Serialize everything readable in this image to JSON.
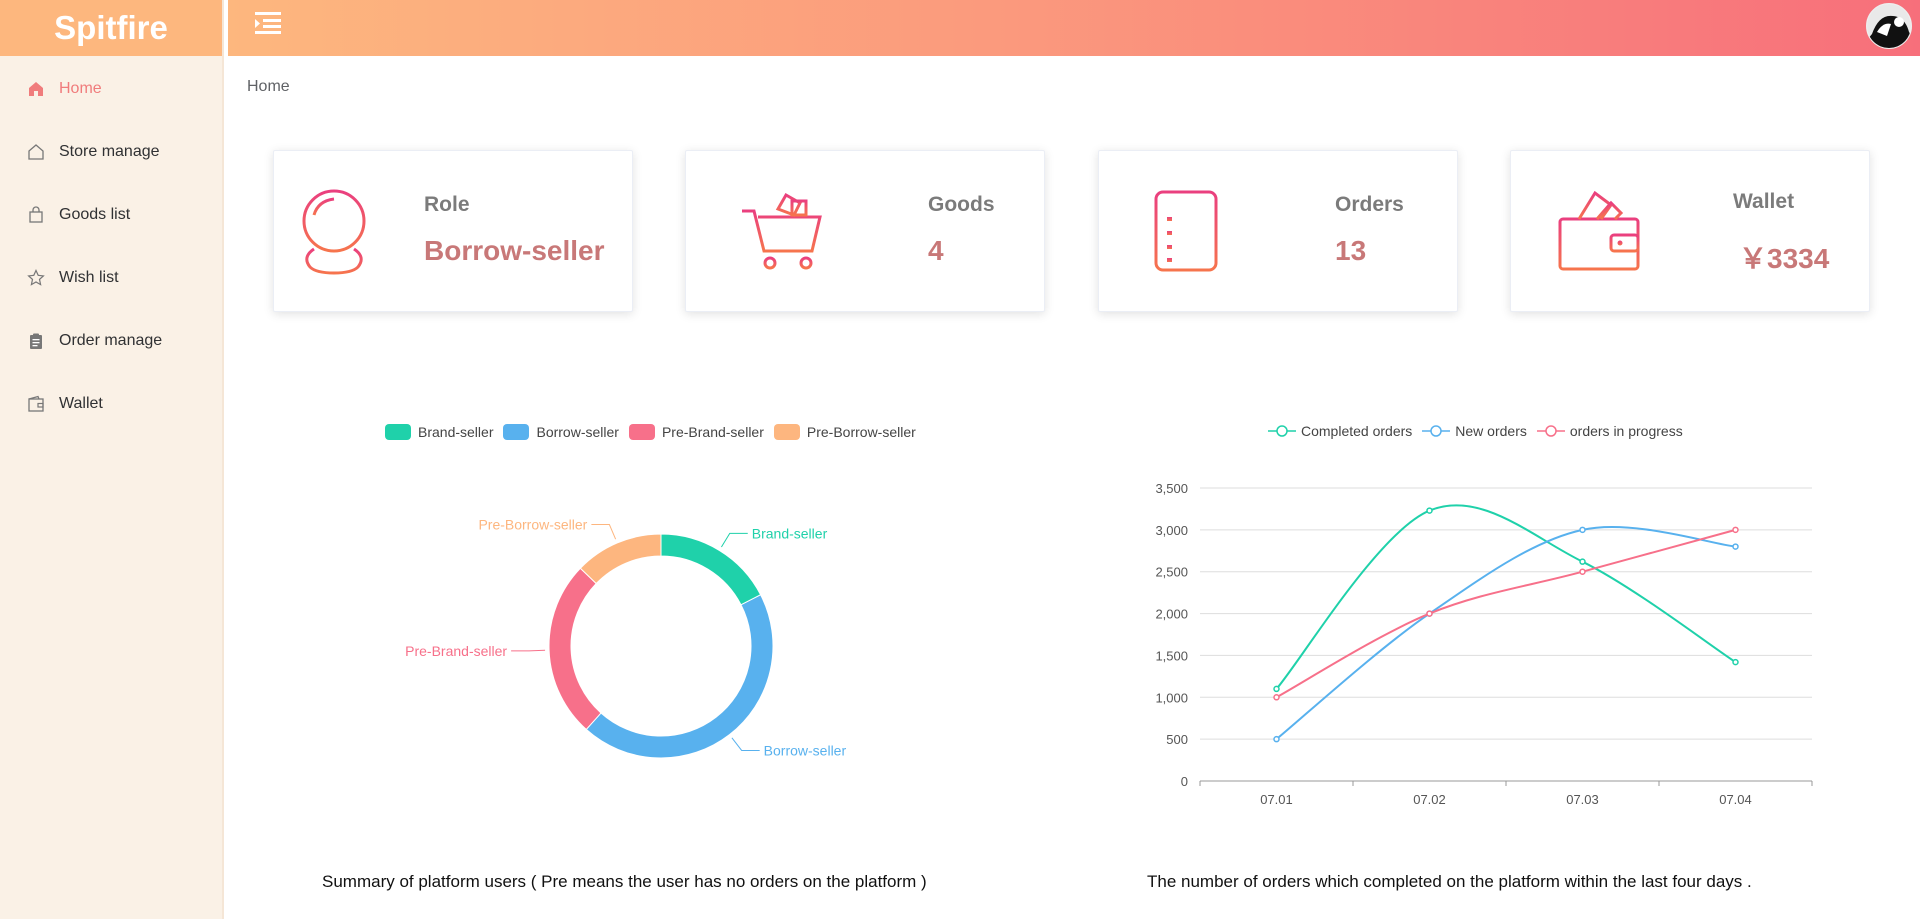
{
  "app": {
    "logo": "Spitfire"
  },
  "sidebar": {
    "items": [
      {
        "label": "Home",
        "icon": "home-icon",
        "active": true
      },
      {
        "label": "Store manage",
        "icon": "store-icon"
      },
      {
        "label": "Goods list",
        "icon": "shopping-bag-icon"
      },
      {
        "label": "Wish list",
        "icon": "star-icon"
      },
      {
        "label": "Order manage",
        "icon": "clipboard-icon"
      },
      {
        "label": "Wallet",
        "icon": "wallet-icon"
      }
    ]
  },
  "header": {
    "menu_icon": "hamburger-icon",
    "avatar_icon": "user-avatar-icon"
  },
  "breadcrumb": "Home",
  "cards": [
    {
      "title": "Role",
      "value": "Borrow-seller",
      "icon": "user-outline-icon"
    },
    {
      "title": "Goods",
      "value": "4",
      "icon": "shopping-cart-icon"
    },
    {
      "title": "Orders",
      "value": "13",
      "icon": "order-list-icon"
    },
    {
      "title": "Wallet",
      "value": "￥3334",
      "icon": "wallet-icon"
    }
  ],
  "colors": {
    "accent": "#f07c7c",
    "brand_seller": "#1fd1aa",
    "borrow_seller": "#58b1ee",
    "pre_brand_seller": "#f7708a",
    "pre_borrow_seller": "#fdb67f",
    "completed": "#1fd1aa",
    "new": "#58b1ee",
    "in_progress": "#f7708a"
  },
  "chart_data": [
    {
      "type": "pie",
      "variant": "donut",
      "legend_position": "top",
      "series": [
        {
          "name": "Brand-seller",
          "value": 15
        },
        {
          "name": "Borrow-seller",
          "value": 38
        },
        {
          "name": "Pre-Brand-seller",
          "value": 22
        },
        {
          "name": "Pre-Borrow-seller",
          "value": 11
        }
      ],
      "caption": "Summary of platform users ( Pre means the user has no orders on the platform )"
    },
    {
      "type": "line",
      "smooth": true,
      "legend_position": "top",
      "categories": [
        "07.01",
        "07.02",
        "07.03",
        "07.04"
      ],
      "ylim": [
        0,
        3500
      ],
      "yticks": [
        "0",
        "500",
        "1,000",
        "1,500",
        "2,000",
        "2,500",
        "3,000",
        "3,500"
      ],
      "ytick_values": [
        0,
        500,
        1000,
        1500,
        2000,
        2500,
        3000,
        3500
      ],
      "grid": true,
      "series": [
        {
          "name": "Completed orders",
          "values": [
            1100,
            3230,
            2620,
            1420
          ]
        },
        {
          "name": "New orders",
          "values": [
            500,
            2000,
            3000,
            2800
          ]
        },
        {
          "name": "orders in progress",
          "values": [
            1000,
            2000,
            2500,
            3000
          ]
        }
      ],
      "caption": "The number of orders which completed on the platform within the last four days ."
    }
  ]
}
